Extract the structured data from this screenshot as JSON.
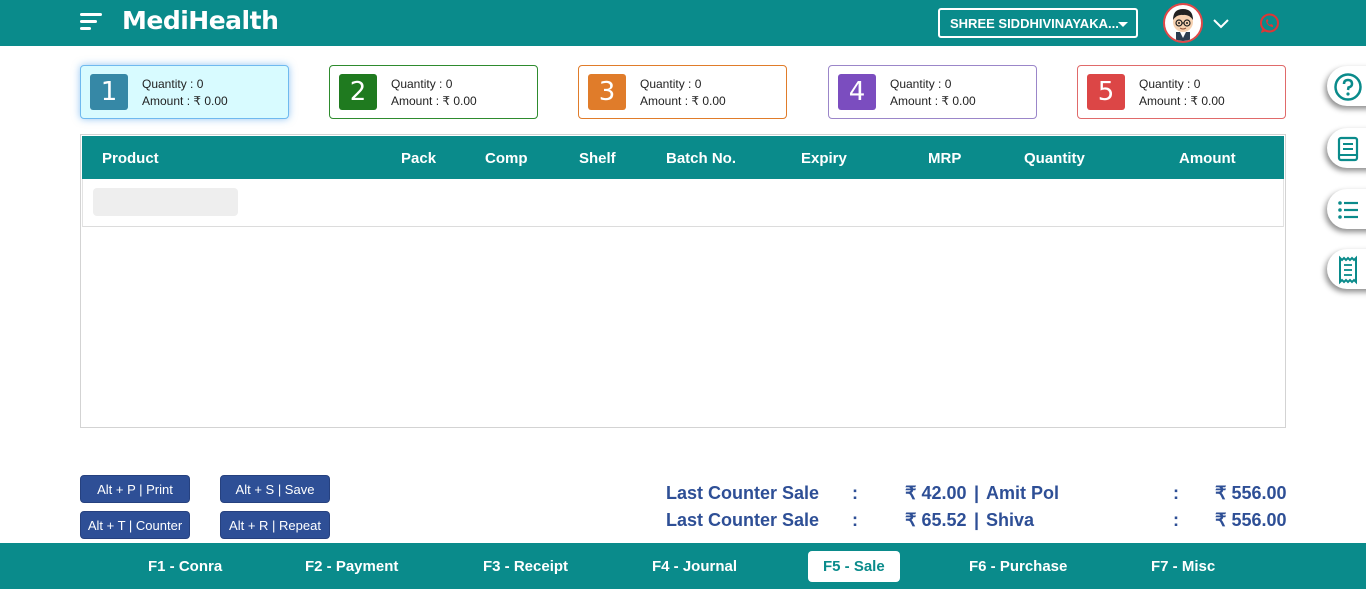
{
  "app": {
    "brand": "MediHealth"
  },
  "header": {
    "store_name": "SHREE SIDDHIVINAYAKA...",
    "icons": [
      "menu-icon",
      "avatar",
      "chevron-down-icon",
      "whatsapp-icon"
    ]
  },
  "counters": [
    {
      "number": "1",
      "quantity": "Quantity : 0",
      "amount": "Amount : ₹ 0.00",
      "color": "#3688a6",
      "border": "#6fb9ef",
      "active": true
    },
    {
      "number": "2",
      "quantity": "Quantity : 0",
      "amount": "Amount : ₹ 0.00",
      "color": "#1f7a1f",
      "border": "#2e8b2e",
      "active": false
    },
    {
      "number": "3",
      "quantity": "Quantity : 0",
      "amount": "Amount : ₹ 0.00",
      "color": "#e07c2a",
      "border": "#e07c2a",
      "active": false
    },
    {
      "number": "4",
      "quantity": "Quantity : 0",
      "amount": "Amount : ₹ 0.00",
      "color": "#7b4dbf",
      "border": "#9b86c9",
      "active": false
    },
    {
      "number": "5",
      "quantity": "Quantity : 0",
      "amount": "Amount : ₹ 0.00",
      "color": "#dc4646",
      "border": "#e06a6a",
      "active": false
    }
  ],
  "table": {
    "columns": [
      "Product",
      "Pack",
      "Comp",
      "Shelf",
      "Batch No.",
      "Expiry",
      "MRP",
      "Quantity",
      "Amount"
    ]
  },
  "side_tabs": [
    "help-icon",
    "book-icon",
    "list-icon",
    "receipt-icon"
  ],
  "shortcuts": {
    "print": "Alt + P | Print",
    "save": "Alt + S | Save",
    "counter": "Alt + T | Counter",
    "repeat": "Alt + R | Repeat"
  },
  "last_sales": [
    {
      "label": "Last Counter Sale",
      "sep": ":",
      "amount": "₹ 42.00",
      "customer": "Amit Pol",
      "sep2": ":",
      "total": "₹ 556.00"
    },
    {
      "label": "Last Counter Sale",
      "sep": ":",
      "amount": "₹ 65.52",
      "customer": "Shiva",
      "sep2": ":",
      "total": "₹ 556.00"
    }
  ],
  "function_keys": [
    {
      "label": "F1 - Conra",
      "active": false
    },
    {
      "label": "F2 - Payment",
      "active": false
    },
    {
      "label": "F3 - Receipt",
      "active": false
    },
    {
      "label": "F4 - Journal",
      "active": false
    },
    {
      "label": "F5 - Sale",
      "active": true
    },
    {
      "label": "F6 - Purchase",
      "active": false
    },
    {
      "label": "F7 - Misc",
      "active": false
    }
  ],
  "colors": {
    "primary": "#0a8b8b",
    "button": "#2e4f96",
    "sales_text": "#2e4f96"
  }
}
